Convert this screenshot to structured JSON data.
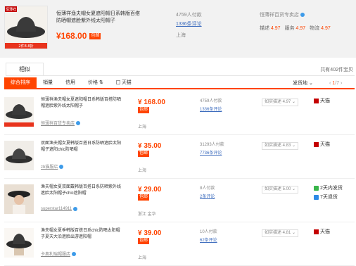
{
  "top": {
    "tag": "恒薄祥",
    "promo": "2件8.8折",
    "title": "恒薄祥渔夫帽女夏遮阳帽日系韩版百搭防晒帽遮脸紫外线太阳帽子",
    "price": "¥168.00",
    "bao": "包邮",
    "sales": "4759人付款",
    "reviews": "1336条评论",
    "location": "上海",
    "shop": "恒薄祥百货专卖店",
    "ratings": [
      {
        "label": "描述",
        "value": "4.97"
      },
      {
        "label": "服务",
        "value": "4.97"
      },
      {
        "label": "物流",
        "value": "4.97"
      }
    ]
  },
  "section": {
    "tab": "相似",
    "total": "共有402件宝贝"
  },
  "sortbar": {
    "items": [
      "综合排序",
      "销量",
      "信用",
      "价格"
    ],
    "tmall": "天猫",
    "ship": "发货地",
    "pager_current": "1",
    "pager_total": "/7"
  },
  "rows": [
    {
      "title": "恒薄祥渔夫帽女夏遮阳帽日系韩版百搭防晒帽遮脸紫外线太阳帽子",
      "shop": "恒薄祥百货专卖店",
      "price": "¥ 168.00",
      "bao": "包邮",
      "location": "上海",
      "sales": "4759人付款",
      "reviews": "1336条评论",
      "desc": "如实描述 4.97",
      "badges": [
        {
          "type": "tmall",
          "label": "天猫"
        }
      ]
    },
    {
      "title": "双面渔夫帽女夏韩版百搭日系防晒遮脸太阳帽子遮阳chic防晒帽",
      "shop": "zb猫服店",
      "price": "¥ 35.00",
      "bao": "包邮",
      "location": "上海",
      "sales": "31293人付款",
      "reviews": "7736条评论",
      "desc": "如实描述 4.83",
      "badges": [
        {
          "type": "tmall",
          "label": "天猫"
        }
      ]
    },
    {
      "title": "渔夫帽女夏双面戴韩版百搭日系防晒紫外线遮脸太阳帽子chic遮阳帽",
      "shop": "superstar114911",
      "price": "¥ 29.00",
      "bao": "包邮",
      "location": "浙江 金华",
      "sales": "8人付款",
      "reviews": "2条评论",
      "desc": "如实描述 5.00",
      "badges": [
        {
          "type": "green",
          "label": "2天内发货"
        },
        {
          "type": "blue",
          "label": "7天退货"
        }
      ]
    },
    {
      "title": "渔夫帽女夏季韩版百搭日系chic防晒太阳帽子夏天大沿遮脸出游遮阳帽",
      "shop": "卡奥利瑞帽服店",
      "price": "¥ 39.00",
      "bao": "包邮",
      "location": "上海",
      "sales": "10人付款",
      "reviews": "62条评论",
      "desc": "如实描述 4.81",
      "badges": [
        {
          "type": "tmall",
          "label": "天猫"
        }
      ]
    }
  ]
}
